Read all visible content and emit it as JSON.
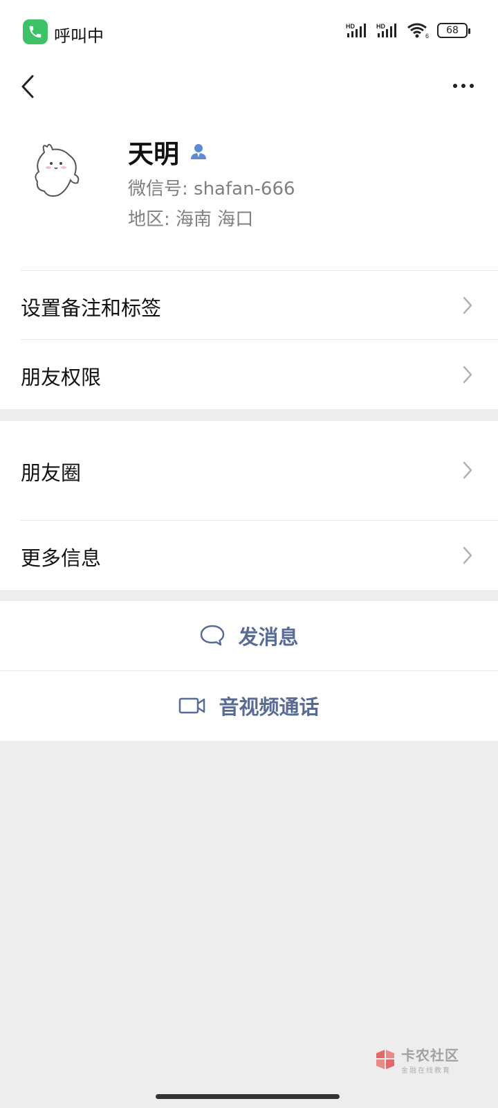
{
  "status_bar": {
    "call_text": "呼叫中",
    "signal1_label": "HD",
    "signal2_label": "HD",
    "wifi_sub": "6",
    "battery": "68"
  },
  "profile": {
    "name": "天明",
    "wechat_id": "微信号:  shafan-666",
    "region": "地区:  海南   海口"
  },
  "menu": {
    "remark": "设置备注和标签",
    "permissions": "朋友权限",
    "moments": "朋友圈",
    "more_info": "更多信息"
  },
  "actions": {
    "send_message": "发消息",
    "video_call": "音视频通话"
  },
  "watermark": {
    "title": "卡农社区",
    "subtitle": "金融在线教育"
  },
  "colors": {
    "link_blue": "#576b95",
    "call_green": "#3dc266",
    "background": "#ededed"
  }
}
